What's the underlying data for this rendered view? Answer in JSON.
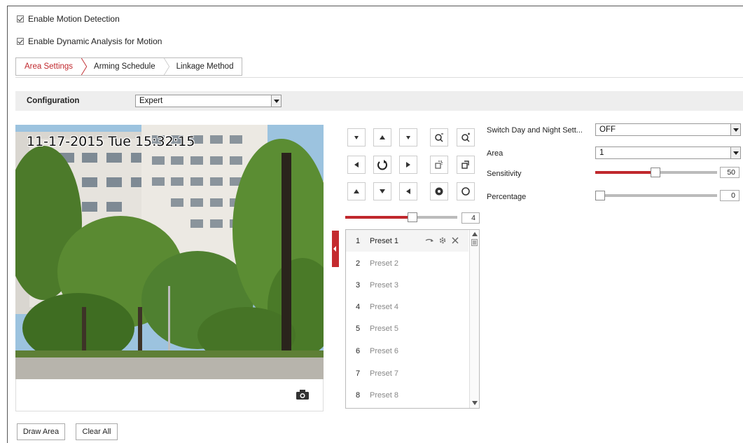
{
  "checkboxes": {
    "motion_detection": "Enable Motion Detection",
    "dynamic_analysis": "Enable Dynamic Analysis for Motion"
  },
  "tabs": [
    {
      "label": "Area Settings",
      "active": true
    },
    {
      "label": "Arming Schedule",
      "active": false
    },
    {
      "label": "Linkage Method",
      "active": false
    }
  ],
  "configuration": {
    "label": "Configuration",
    "value": "Expert"
  },
  "video": {
    "osd_text": "11-17-2015 Tue 15:32:15"
  },
  "ptz": {
    "speed_value": "4",
    "speed_level": 0.6
  },
  "presets": [
    {
      "num": "1",
      "name": "Preset 1"
    },
    {
      "num": "2",
      "name": "Preset 2"
    },
    {
      "num": "3",
      "name": "Preset 3"
    },
    {
      "num": "4",
      "name": "Preset 4"
    },
    {
      "num": "5",
      "name": "Preset 5"
    },
    {
      "num": "6",
      "name": "Preset 6"
    },
    {
      "num": "7",
      "name": "Preset 7"
    },
    {
      "num": "8",
      "name": "Preset 8"
    }
  ],
  "settings": {
    "switch_day_night_label": "Switch Day and Night Sett...",
    "switch_day_night_value": "OFF",
    "area_label": "Area",
    "area_value": "1",
    "sensitivity_label": "Sensitivity",
    "sensitivity_value": "50",
    "percentage_label": "Percentage",
    "percentage_value": "0"
  },
  "buttons": {
    "draw_area": "Draw Area",
    "clear_all": "Clear All"
  },
  "colors": {
    "accent": "#c0282d"
  }
}
